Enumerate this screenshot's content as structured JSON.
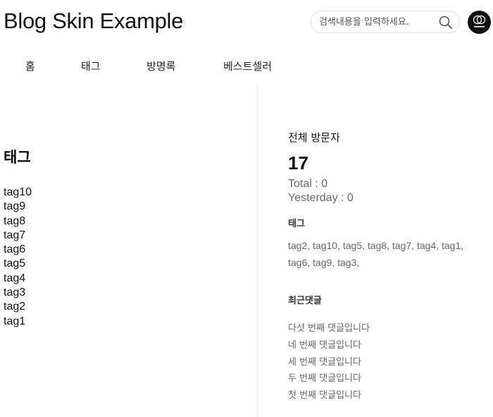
{
  "header": {
    "title": "Blog Skin Example",
    "search_placeholder": "검색내용을 입력하세요.",
    "search_icon": "search-icon",
    "logo_icon": "blog-logo-icon"
  },
  "nav": {
    "items": [
      {
        "label": "홈"
      },
      {
        "label": "태그"
      },
      {
        "label": "방명록"
      },
      {
        "label": "베스트셀러"
      }
    ]
  },
  "main": {
    "heading": "태그",
    "tags": [
      "tag10",
      "tag9",
      "tag8",
      "tag7",
      "tag6",
      "tag5",
      "tag4",
      "tag3",
      "tag2",
      "tag1"
    ]
  },
  "sidebar": {
    "visitors": {
      "heading": "전체 방문자",
      "count": "17",
      "total": "Total : 0",
      "yesterday": "Yesterday : 0"
    },
    "tags": {
      "heading": "태그",
      "items": [
        "tag2,",
        "tag10,",
        "tag5,",
        "tag8,",
        "tag7,",
        "tag4,",
        "tag1,",
        "tag6,",
        "tag9,",
        "tag3,"
      ]
    },
    "recent_comments": {
      "heading": "최근댓글",
      "items": [
        "다섯 번째 댓글입니다",
        "네 번째 댓글입니다",
        "세 번째 댓글입니다",
        "두 번째 댓글입니다",
        "첫 번째 댓글입니다"
      ]
    }
  },
  "colors": {
    "text": "#111111",
    "muted": "#666666",
    "logo_bg": "#111111",
    "border": "#e3e3e3"
  }
}
